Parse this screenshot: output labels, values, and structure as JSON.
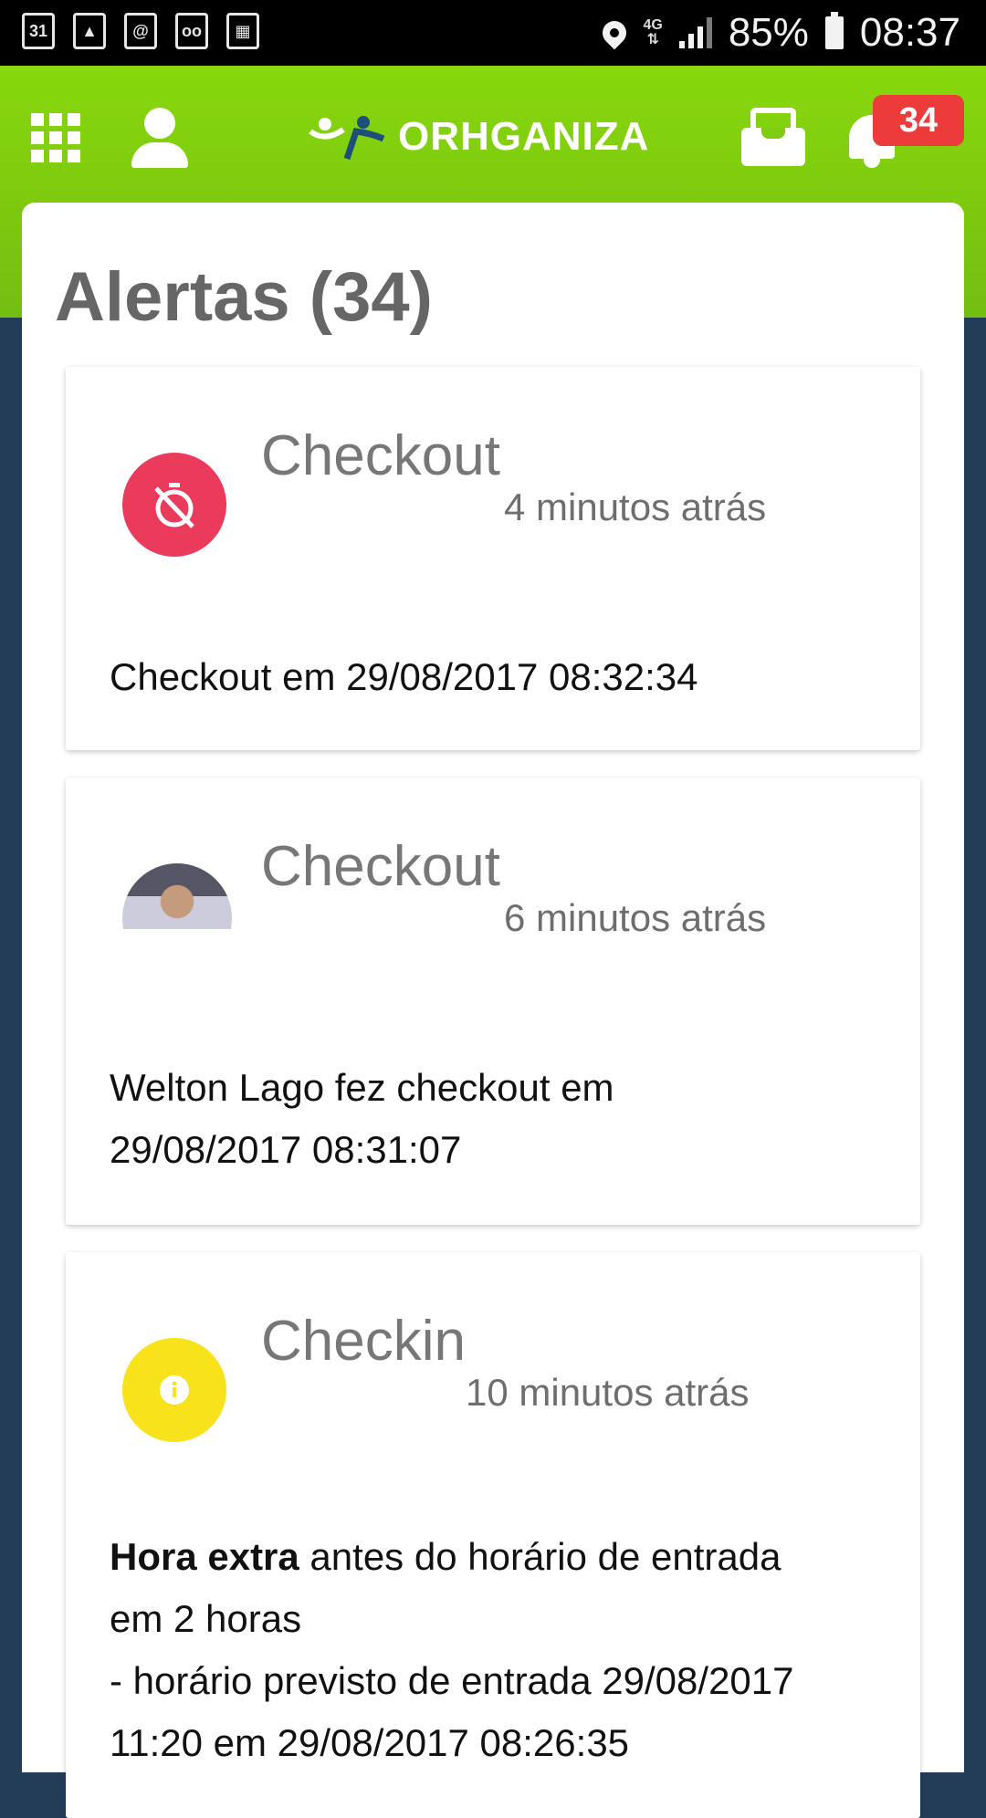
{
  "status_bar": {
    "calendar_day": "31",
    "network": "4G",
    "battery": "85%",
    "time": "08:37",
    "icons": [
      "calendar-icon",
      "image-icon",
      "email-icon",
      "voicemail-icon",
      "calendar-grid-icon",
      "location-icon",
      "signal-icon",
      "battery-icon"
    ]
  },
  "app_bar": {
    "logo_text": "ORHGANIZA",
    "notification_count": "34",
    "colors": {
      "bar": "#7cc90f",
      "badge": "#ed3b3b"
    }
  },
  "page": {
    "title": "Alertas (34)"
  },
  "alerts": [
    {
      "title": "Checkout",
      "time": "4 minutos atrás",
      "body": "Checkout em 29/08/2017 08:32:34",
      "icon": "timer-off-icon",
      "icon_color": "#ea3b5c"
    },
    {
      "title": "Checkout",
      "time": "6 minutos atrás",
      "body_line1": "Welton Lago fez checkout em",
      "body_line2": "29/08/2017 08:31:07",
      "icon": "avatar"
    },
    {
      "title": "Checkin",
      "time": "10 minutos atrás",
      "body_bold": "Hora extra",
      "body_rest": " antes do horário de entrada",
      "body_line2": "em 2 horas",
      "body_line3": "- horário previsto de entrada 29/08/2017",
      "body_line4": "11:20 em 29/08/2017 08:26:35",
      "icon": "info-icon",
      "icon_color": "#f7e21b"
    }
  ]
}
